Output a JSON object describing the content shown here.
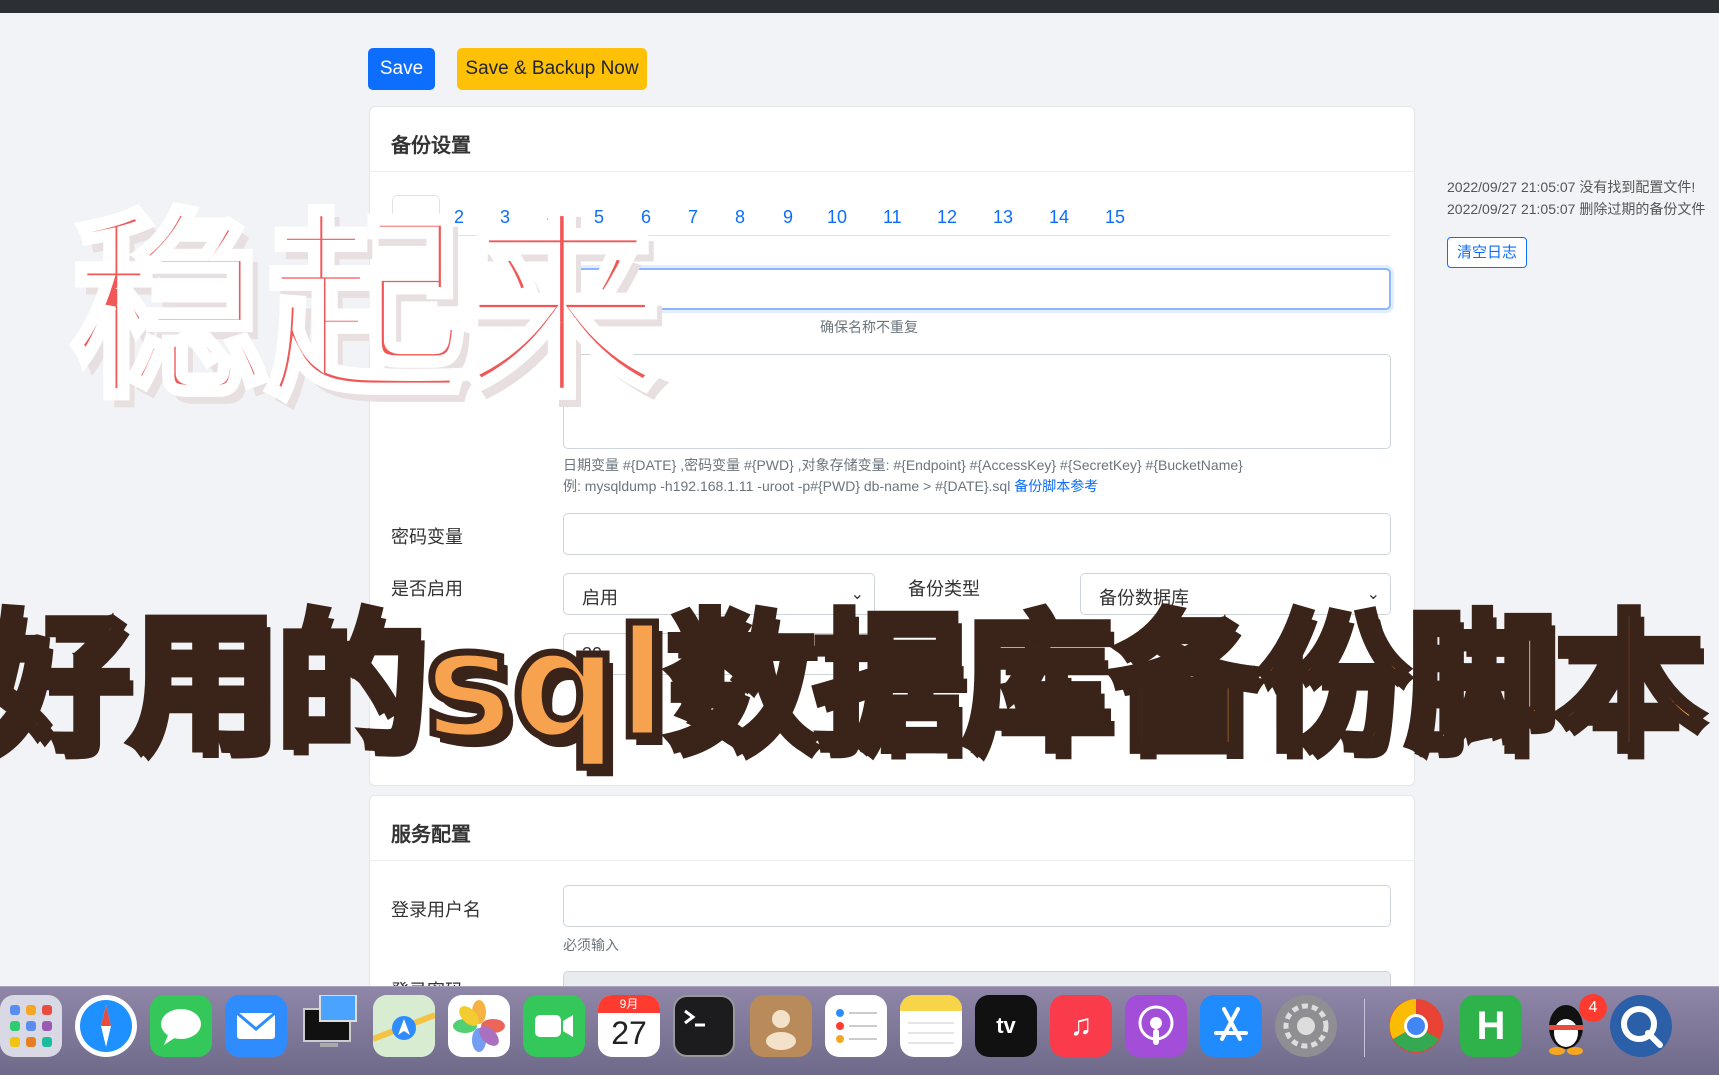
{
  "toolbar": {
    "save_label": "Save",
    "backup_label": "Save & Backup Now"
  },
  "backup_card": {
    "title": "备份设置",
    "tabs": [
      "1",
      "2",
      "3",
      "4",
      "5",
      "6",
      "7",
      "8",
      "9",
      "10",
      "11",
      "12",
      "13",
      "14",
      "15"
    ],
    "name_hint": "确保名称不重复",
    "command_hint_1": "日期变量 #{DATE} ,密码变量 #{PWD} ,对象存储变量: #{Endpoint} #{AccessKey} #{SecretKey} #{BucketName}",
    "command_hint_2": "例: mysqldump -h192.168.1.11 -uroot -p#{PWD} db-name > #{DATE}.sql",
    "command_hint_link": "备份脚本参考",
    "password_label": "密码变量",
    "enabled_label": "是否启用",
    "enabled_value": "启用",
    "type_label": "备份类型",
    "type_value": "备份数据库",
    "days_value": "30"
  },
  "service_card": {
    "title": "服务配置",
    "username_label": "登录用户名",
    "username_hint": "必须输入",
    "password_label": "登录密码"
  },
  "logs": {
    "lines": [
      "2022/09/27 21:05:07 没有找到配置文件!",
      "2022/09/27 21:05:07 删除过期的备份文件"
    ],
    "clear_label": "清空日志"
  },
  "overlay": {
    "line1": "稳起来",
    "line2": "好用的sql数据库备份脚本"
  },
  "dock": {
    "calendar_month": "9月",
    "calendar_day": "27",
    "qq_badge": "4",
    "apps": [
      "launchpad",
      "safari",
      "messages",
      "mail",
      "screen-sharing",
      "maps",
      "photos",
      "facetime",
      "calendar",
      "terminal",
      "contacts",
      "reminders",
      "notes",
      "tv",
      "music",
      "podcasts",
      "app-store",
      "system-preferences",
      "chrome",
      "hbuilder",
      "qq",
      "quicktime"
    ]
  },
  "colors": {
    "primary": "#0d6efd",
    "warning": "#ffc107",
    "overlay_red": "#f25757",
    "overlay_orange": "#f7a24f"
  }
}
